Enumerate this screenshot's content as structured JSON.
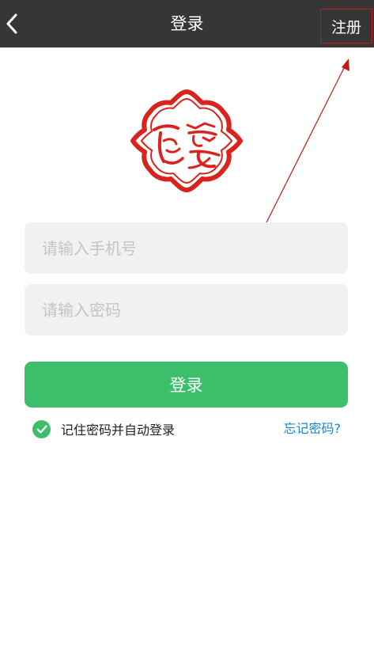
{
  "nav": {
    "title": "登录",
    "register_label": "注册",
    "background": "#363636"
  },
  "icons": {
    "back": "chevron-left-icon",
    "logo": "brand-logo",
    "check": "check-circle-icon"
  },
  "form": {
    "phone_placeholder": "请输入手机号",
    "phone_value": "",
    "password_placeholder": "请输入密码",
    "password_value": "",
    "login_label": "登录",
    "remember_label": "记住密码并自动登录",
    "remember_checked": true,
    "forgot_label": "忘记密码?"
  },
  "colors": {
    "accent_green": "#3cbe6a",
    "link_blue": "#1a86d0",
    "annotation_red": "#c11b17",
    "logo_red": "#d9231d"
  }
}
